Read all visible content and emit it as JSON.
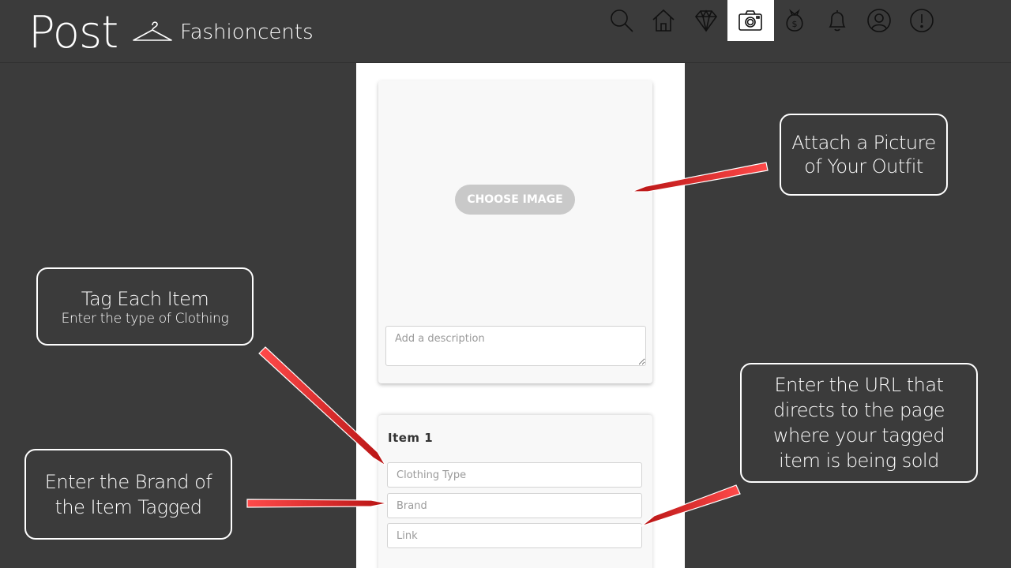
{
  "header": {
    "title": "Post",
    "brand_name": "Fashioncents",
    "nav": [
      {
        "icon": "search-icon"
      },
      {
        "icon": "home-icon"
      },
      {
        "icon": "diamond-icon"
      },
      {
        "icon": "camera-icon",
        "active": true
      },
      {
        "icon": "money-bag-icon"
      },
      {
        "icon": "bell-icon"
      },
      {
        "icon": "profile-icon"
      },
      {
        "icon": "alert-icon"
      }
    ]
  },
  "image_card": {
    "choose_image_label": "CHOOSE IMAGE",
    "description_placeholder": "Add a description"
  },
  "item_card": {
    "title": "Item 1",
    "clothing_type_placeholder": "Clothing Type",
    "brand_placeholder": "Brand",
    "link_placeholder": "Link"
  },
  "callouts": {
    "attach": "Attach a Picture of Your Outfit",
    "tag_title": "Tag Each Item",
    "tag_sub": "Enter the type of Clothing",
    "brand": "Enter the Brand of the Item Tagged",
    "url": "Enter the URL that directs to the page where your tagged item is being sold"
  },
  "colors": {
    "background": "#3b3b3b",
    "arrow": "#cc1f1f",
    "button": "#c9c9c9"
  }
}
